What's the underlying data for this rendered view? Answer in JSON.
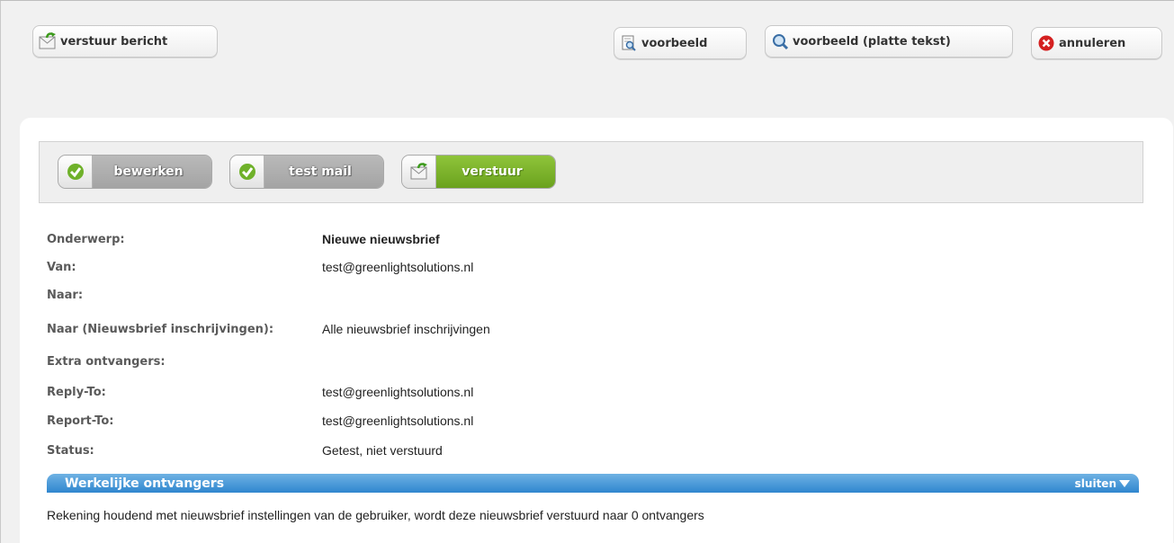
{
  "toolbar": {
    "send_label": "verstuur bericht",
    "preview_label": "voorbeeld",
    "preview_plain_label": "voorbeeld (platte tekst)",
    "cancel_label": "annuleren"
  },
  "steps": [
    {
      "label": "bewerken",
      "state": "done"
    },
    {
      "label": "test mail",
      "state": "done"
    },
    {
      "label": "verstuur",
      "state": "active"
    }
  ],
  "details": {
    "subject_label": "Onderwerp:",
    "subject_value": "Nieuwe nieuwsbrief",
    "from_label": "Van:",
    "from_value": "test@greenlightsolutions.nl",
    "to_label": "Naar:",
    "to_value": "",
    "to_newsletter_label": "Naar (Nieuwsbrief inschrijvingen):",
    "to_newsletter_value": "Alle nieuwsbrief inschrijvingen",
    "extra_label": "Extra ontvangers:",
    "extra_value": "",
    "reply_to_label": "Reply-To:",
    "reply_to_value": "test@greenlightsolutions.nl",
    "report_to_label": "Report-To:",
    "report_to_value": "test@greenlightsolutions.nl",
    "status_label": "Status:",
    "status_value": "Getest, niet verstuurd"
  },
  "recipients_bar": {
    "title": "Werkelijke ontvangers",
    "close_label": "sluiten"
  },
  "recipients_text": "Rekening houdend met nieuwsbrief instellingen van de gebruiker, wordt deze nieuwsbrief verstuurd naar 0 ontvangers",
  "colors": {
    "accent_green": "#7ab32a",
    "accent_blue": "#3b8fd3",
    "cancel_red": "#d42020"
  }
}
